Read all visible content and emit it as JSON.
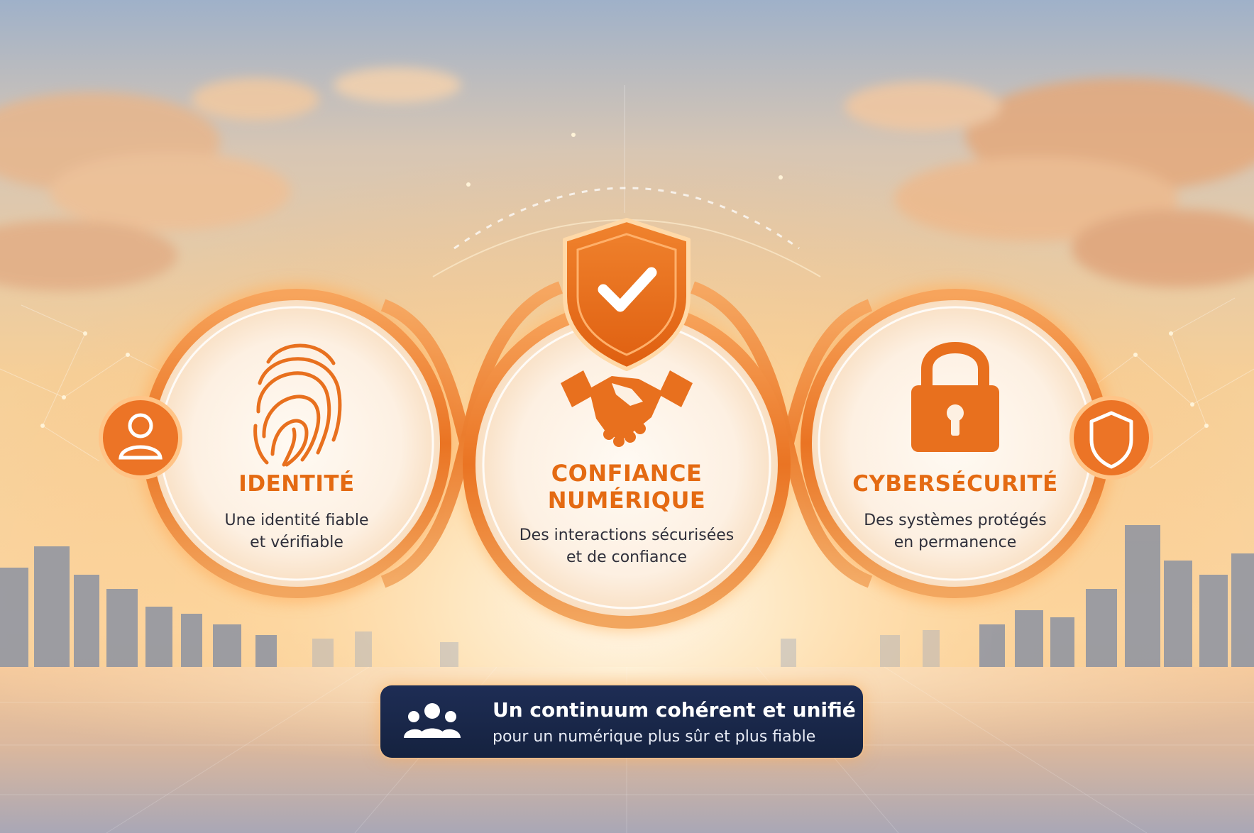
{
  "colors": {
    "accent": "#ea6f1c",
    "accent_dark": "#d85c10",
    "banner_bg": "#17254a",
    "text_dark": "#2f2f3a"
  },
  "pillars": [
    {
      "icon": "fingerprint-icon",
      "badge_icon": "user-icon",
      "title": "IDENTITÉ",
      "desc_lines": [
        "Une identité fiable",
        "et vérifiable"
      ]
    },
    {
      "icon": "handshake-icon",
      "badge_icon": "shield-check-icon",
      "title_lines": [
        "CONFIANCE",
        "NUMÉRIQUE"
      ],
      "desc_lines": [
        "Des interactions sécurisées",
        "et de confiance"
      ]
    },
    {
      "icon": "padlock-icon",
      "badge_icon": "shield-icon",
      "title": "CYBERSÉCURITÉ",
      "desc_lines": [
        "Des systèmes protégés",
        "en permanence"
      ]
    }
  ],
  "banner": {
    "icon": "users-group-icon",
    "title": "Un continuum cohérent et unifié",
    "subtitle": "pour un numérique plus sûr et plus fiable"
  }
}
